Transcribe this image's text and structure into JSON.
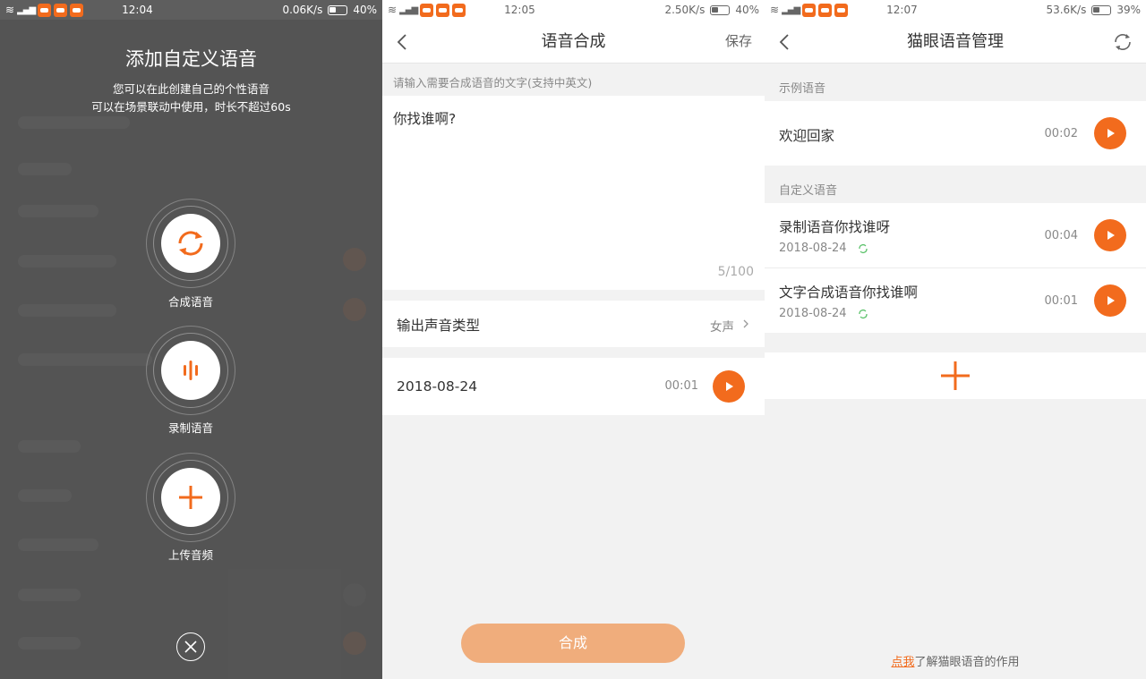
{
  "colors": {
    "accent": "#f26b1d",
    "accent_light": "#f0ad7c",
    "text": "#333333",
    "muted": "#888888"
  },
  "status_bars": [
    {
      "time": "12:04",
      "speed": "0.06K/s",
      "battery": "40%"
    },
    {
      "time": "12:05",
      "speed": "2.50K/s",
      "battery": "40%"
    },
    {
      "time": "12:07",
      "speed": "53.6K/s",
      "battery": "39%"
    }
  ],
  "add_custom": {
    "title": "添加自定义语音",
    "subtitle_line1": "您可以在此创建自己的个性语音",
    "subtitle_line2": "可以在场景联动中使用，时长不超过60s",
    "options": [
      {
        "label": "合成语音",
        "icon": "refresh-icon"
      },
      {
        "label": "录制语音",
        "icon": "waveform-icon"
      },
      {
        "label": "上传音频",
        "icon": "plus-icon"
      }
    ],
    "close_icon": "close-icon"
  },
  "synthesis": {
    "title": "语音合成",
    "save_label": "保存",
    "hint": "请输入需要合成语音的文字(支持中英文)",
    "text": "你找谁啊?",
    "count": "5/100",
    "voice_type_label": "输出声音类型",
    "voice_type_value": "女声",
    "result_date": "2018-08-24",
    "result_duration": "00:01",
    "synth_button": "合成"
  },
  "manage": {
    "title": "猫眼语音管理",
    "sample_section": "示例语音",
    "sample_item": {
      "title": "欢迎回家",
      "duration": "00:02"
    },
    "custom_section": "自定义语音",
    "custom_items": [
      {
        "title": "录制语音你找谁呀",
        "date": "2018-08-24",
        "duration": "00:04"
      },
      {
        "title": "文字合成语音你找谁啊",
        "date": "2018-08-24",
        "duration": "00:01"
      }
    ],
    "footer_link": "点我",
    "footer_text": "了解猫眼语音的作用"
  }
}
